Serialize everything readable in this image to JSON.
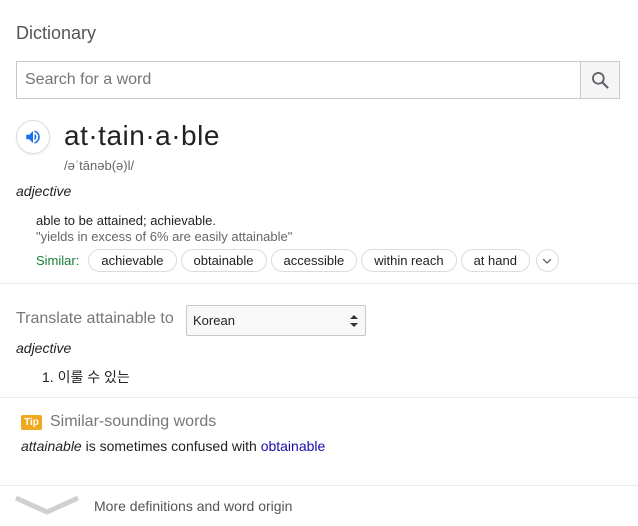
{
  "header": {
    "title": "Dictionary"
  },
  "search": {
    "placeholder": "Search for a word",
    "value": ""
  },
  "entry": {
    "headword": "at·tain·a·ble",
    "phonetic": "/əˈtānəb(ə)l/",
    "part_of_speech": "adjective",
    "definition": "able to be attained; achievable.",
    "example": "\"yields in excess of 6% are easily attainable\"",
    "similar_label": "Similar:",
    "similar_words": [
      "achievable",
      "obtainable",
      "accessible",
      "within reach",
      "at hand"
    ]
  },
  "translate": {
    "label": "Translate attainable to",
    "selected_language": "Korean",
    "part_of_speech": "adjective",
    "translations": [
      "1. 이룰 수 있는"
    ]
  },
  "tip": {
    "badge": "Tip",
    "title": "Similar-sounding words",
    "word": "attainable",
    "middle_text": " is sometimes confused with ",
    "link_word": "obtainable"
  },
  "footer": {
    "more_label": "More definitions and word origin"
  },
  "colors": {
    "similar_label": "#188038",
    "link": "#1a0dab",
    "tip_badge": "#f0a81e",
    "speaker_icon": "#1a73e8"
  }
}
